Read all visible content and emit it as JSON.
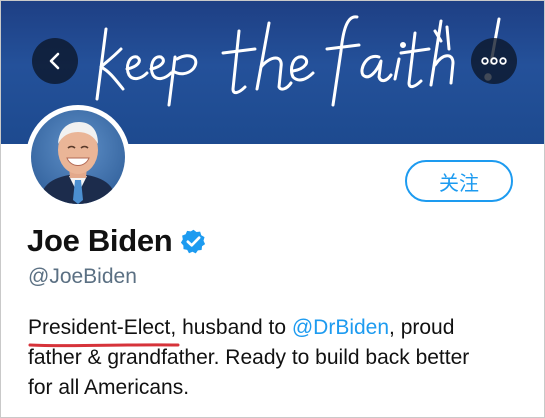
{
  "banner": {
    "script_text": "keep the faith!",
    "colors": {
      "background": "#24519a",
      "ink": "#ffffff"
    }
  },
  "nav": {
    "back_icon": "chevron-left-icon",
    "more_icon": "more-horizontal-icon"
  },
  "profile": {
    "name": "Joe Biden",
    "verified_icon": "verified-badge-icon",
    "handle": "@JoeBiden",
    "follow_label": "关注",
    "bio": {
      "title": "President-Elect",
      "part1": ", husband to ",
      "mention": "@DrBiden",
      "part2": ", proud",
      "line2": "father & grandfather. Ready to build back better",
      "line3": "for all Americans."
    }
  },
  "colors": {
    "accent": "#1d9bf0",
    "underline": "#d6333a",
    "handle": "#5b7083"
  }
}
